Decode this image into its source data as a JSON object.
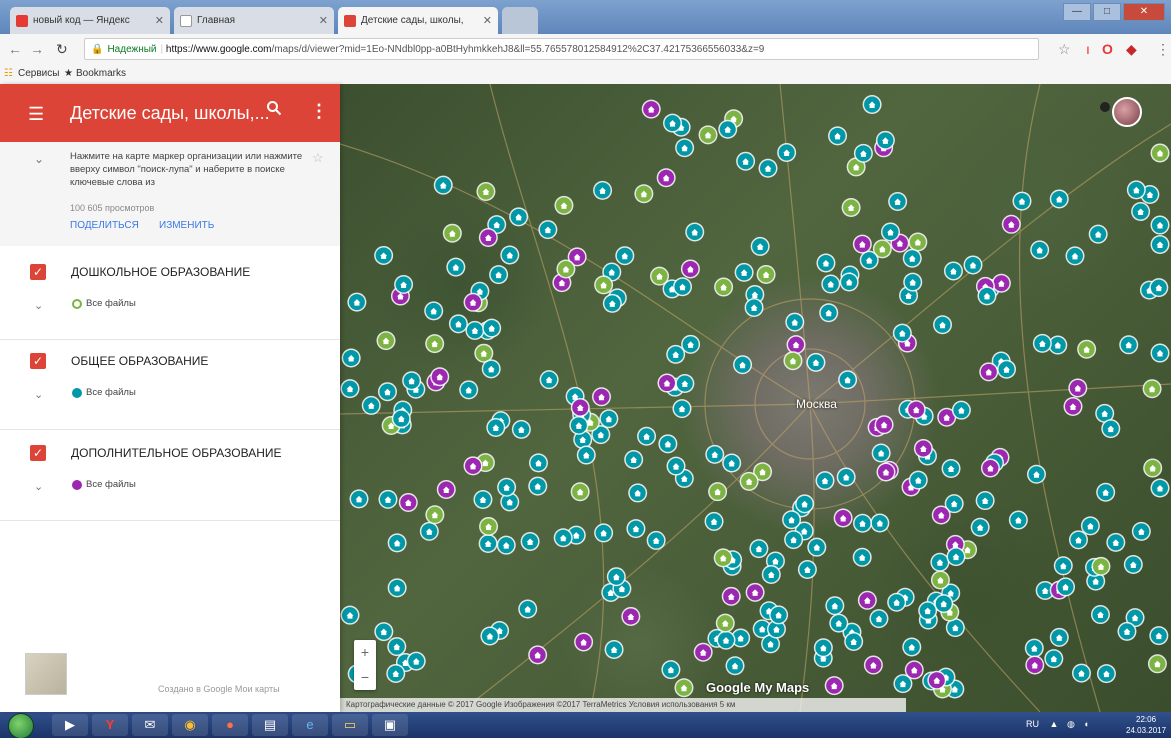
{
  "browser": {
    "tabs": [
      {
        "label": "новый код — Яндекс"
      },
      {
        "label": "Главная"
      },
      {
        "label": "Детские сады, школы,"
      }
    ],
    "window_buttons": {
      "minimize": "—",
      "maximize": "□",
      "close": "✕"
    },
    "address": {
      "security_label": "Надежный",
      "host": "https://www.google.com",
      "path": "/maps/d/viewer?mid=1Eo-NNdbl0pp-a0BtHyhmkkehJ8&ll=55.765578012584912%2C37.42175366556033&z=9"
    },
    "bookmarks": {
      "services": "Сервисы",
      "bookmarks": "Bookmarks"
    }
  },
  "panel": {
    "title": "Детские сады, школы,...",
    "description": "Нажмите на карте маркер организации или нажмите вверху символ \"поиск-лупа\" и наберите в поиске ключевые слова из",
    "views": "100 605 просмотров",
    "share_label": "ПОДЕЛИТЬСЯ",
    "edit_label": "ИЗМЕНИТЬ",
    "layers": [
      {
        "title": "ДОШКОЛЬНОЕ ОБРАЗОВАНИЕ",
        "files": "Все файлы",
        "color": "#7cb342"
      },
      {
        "title": "ОБЩЕЕ ОБРАЗОВАНИЕ",
        "files": "Все файлы",
        "color": "#0097a7"
      },
      {
        "title": "ДОПОЛНИТЕЛЬНОЕ ОБРАЗОВАНИЕ",
        "files": "Все файлы",
        "color": "#9c27b0"
      }
    ],
    "credit": "Создано в Google Мои карты"
  },
  "map": {
    "city": "Москва",
    "logo": "Google My Maps",
    "attribution": "Картографические данные © 2017 Google Изображения ©2017 TerraMetrics   Условия использования   5 км",
    "zoom_in": "+",
    "zoom_out": "−",
    "marker_colors": {
      "teal": "#0097a7",
      "green": "#7cb342",
      "purple": "#9c27b0"
    }
  },
  "taskbar": {
    "lang": "RU",
    "time": "22:06",
    "date": "24.03.2017"
  }
}
